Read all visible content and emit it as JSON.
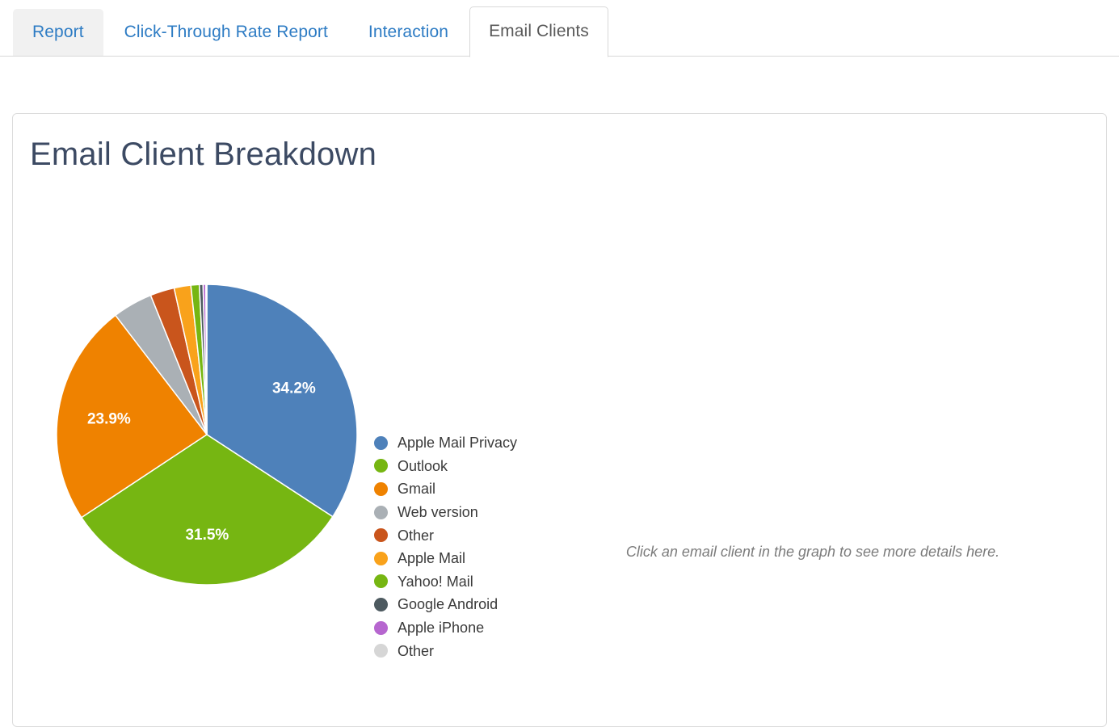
{
  "tabs": [
    {
      "label": "Report",
      "state": "hovered"
    },
    {
      "label": "Click-Through Rate Report",
      "state": "default"
    },
    {
      "label": "Interaction",
      "state": "default"
    },
    {
      "label": "Email Clients",
      "state": "active"
    }
  ],
  "card": {
    "title": "Email Client Breakdown",
    "detail_placeholder": "Click an email client in the graph to see more details here."
  },
  "colors": {
    "tab_link": "#2e7cc4",
    "tab_active_text": "#595959",
    "title": "#3c4a63",
    "card_border": "#dcdcdc",
    "placeholder_text": "#7b7b7b"
  },
  "chart_data": {
    "type": "pie",
    "title": "Email Client Breakdown",
    "legend_position": "right",
    "start_angle_deg": 0,
    "direction": "clockwise",
    "value_unit": "percent",
    "labeled_threshold_percent": 20,
    "categories": [
      "Apple Mail Privacy",
      "Outlook",
      "Gmail",
      "Web version",
      "Other",
      "Apple Mail",
      "Yahoo! Mail",
      "Google Android",
      "Apple iPhone",
      "Other"
    ],
    "values": [
      34.2,
      31.5,
      23.9,
      4.3,
      2.6,
      1.8,
      0.9,
      0.4,
      0.3,
      0.1
    ],
    "slice_labels": [
      "34.2%",
      "31.5%",
      "23.9%",
      "",
      "",
      "",
      "",
      "",
      "",
      ""
    ],
    "colors": [
      "#4e81ba",
      "#76b612",
      "#ef8200",
      "#aab0b5",
      "#c9551c",
      "#f9a21b",
      "#76b612",
      "#4d5a60",
      "#b666cf",
      "#d6d6d6"
    ]
  }
}
